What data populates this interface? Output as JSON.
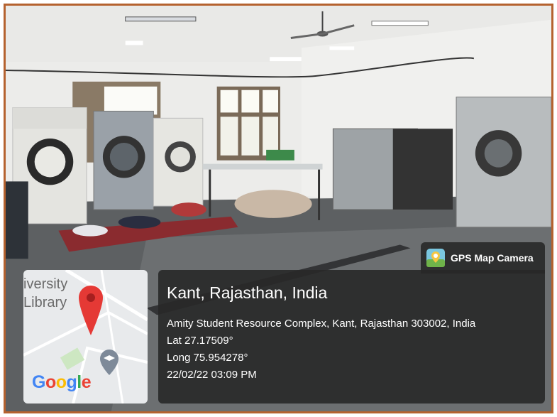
{
  "badge": {
    "label": "GPS Map Camera",
    "icon": "camera-pin-icon"
  },
  "location": {
    "title": "Kant, Rajasthan, India",
    "address": "Amity Student Resource Complex, Kant, Rajasthan 303002, India",
    "lat": "Lat 27.17509°",
    "long": "Long 75.954278°",
    "datetime": "22/02/22 03:09 PM"
  },
  "map": {
    "label_line1": "iversity",
    "label_line2": "Library",
    "google_logo": {
      "g1": "G",
      "o1": "o",
      "o2": "o",
      "g2": "g",
      "l": "l",
      "e": "e"
    },
    "pin_color": "#e53935",
    "icons": [
      "location-pin-icon",
      "graduation-cap-icon"
    ]
  },
  "colors": {
    "frame": "#b5622f",
    "overlay": "#282828"
  }
}
